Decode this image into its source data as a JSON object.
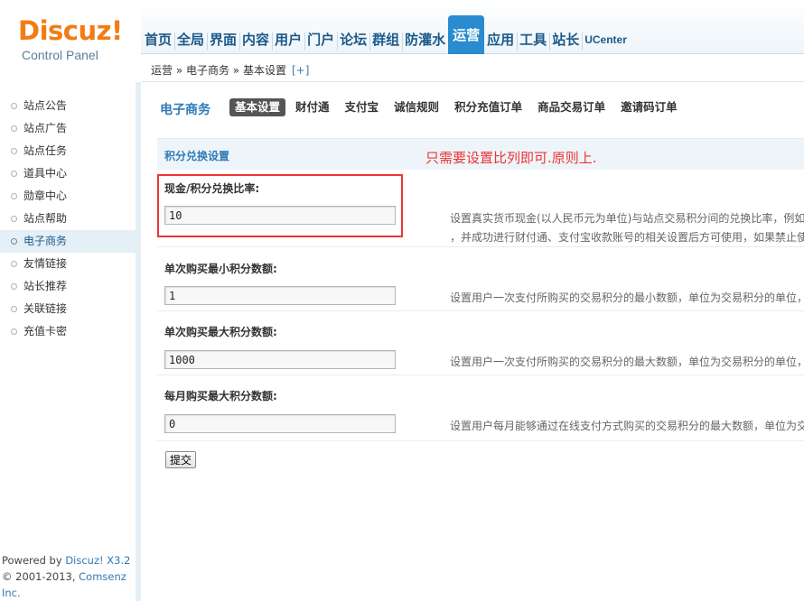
{
  "header": {
    "logo_main": "Discuz!",
    "logo_sub": "Control Panel",
    "nav": [
      {
        "label": "首页",
        "active": false
      },
      {
        "label": "全局",
        "active": false
      },
      {
        "label": "界面",
        "active": false
      },
      {
        "label": "内容",
        "active": false
      },
      {
        "label": "用户",
        "active": false
      },
      {
        "label": "门户",
        "active": false
      },
      {
        "label": "论坛",
        "active": false
      },
      {
        "label": "群组",
        "active": false
      },
      {
        "label": "防灌水",
        "active": false
      },
      {
        "label": "运营",
        "active": true
      },
      {
        "label": "应用",
        "active": false
      },
      {
        "label": "工具",
        "active": false
      },
      {
        "label": "站长",
        "active": false
      },
      {
        "label": "UCenter",
        "active": false
      }
    ]
  },
  "breadcrumb": {
    "text": "运营 » 电子商务 » 基本设置",
    "plus": "[+]"
  },
  "sidebar": {
    "items": [
      {
        "label": "站点公告",
        "active": false
      },
      {
        "label": "站点广告",
        "active": false
      },
      {
        "label": "站点任务",
        "active": false
      },
      {
        "label": "道具中心",
        "active": false
      },
      {
        "label": "勋章中心",
        "active": false
      },
      {
        "label": "站点帮助",
        "active": false
      },
      {
        "label": "电子商务",
        "active": true
      },
      {
        "label": "友情链接",
        "active": false
      },
      {
        "label": "站长推荐",
        "active": false
      },
      {
        "label": "关联链接",
        "active": false
      },
      {
        "label": "充值卡密",
        "active": false
      }
    ],
    "footer_line1_prefix": "Powered by ",
    "footer_line1_link": "Discuz! X3.2",
    "footer_line2_prefix": "© 2001-2013, ",
    "footer_line2_link": "Comsenz Inc."
  },
  "main": {
    "title": "电子商务",
    "tabs": [
      {
        "label": "基本设置",
        "active": true
      },
      {
        "label": "财付通",
        "active": false
      },
      {
        "label": "支付宝",
        "active": false
      },
      {
        "label": "诚信规则",
        "active": false
      },
      {
        "label": "积分充值订单",
        "active": false
      },
      {
        "label": "商品交易订单",
        "active": false
      },
      {
        "label": "邀请码订单",
        "active": false
      }
    ],
    "section_title": "积分兑换设置",
    "annotation": "只需要设置比列即可.原则上.",
    "rows": [
      {
        "label": "现金/积分兑换比率:",
        "value": "10",
        "desc_line1": "设置真实货币现金(以人民币元为单位)与站点交易积分间的兑换比率，例如",
        "desc_line2": "，并成功进行财付通、支付宝收款账号的相关设置后方可使用，如果禁止使"
      },
      {
        "label": "单次购买最小积分数额:",
        "value": "1",
        "desc_line1": "设置用户一次支付所购买的交易积分的最小数额，单位为交易积分的单位，"
      },
      {
        "label": "单次购买最大积分数额:",
        "value": "1000",
        "desc_line1": "设置用户一次支付所购买的交易积分的最大数额，单位为交易积分的单位，"
      },
      {
        "label": "每月购买最大积分数额:",
        "value": "0",
        "desc_line1": "设置用户每月能够通过在线支付方式购买的交易积分的最大数额，单位为交"
      }
    ],
    "submit_label": "提交"
  },
  "colors": {
    "accent": "#2a8bd0",
    "logo": "#f27c14",
    "annotation": "#ee3333"
  }
}
